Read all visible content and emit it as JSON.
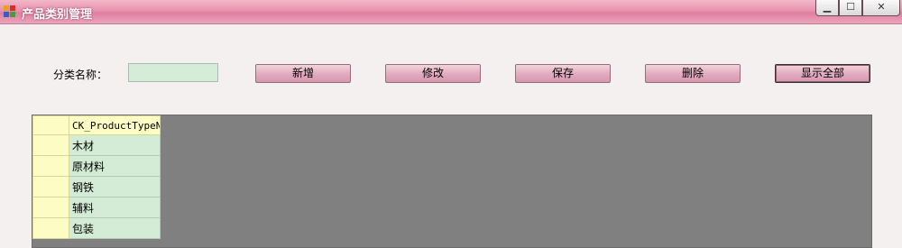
{
  "window": {
    "title": "产品类别管理",
    "caption_buttons": {
      "minimize": "▁",
      "maximize": "☐",
      "close": "✕"
    }
  },
  "form": {
    "label": "分类名称：",
    "name_value": "",
    "name_placeholder": ""
  },
  "buttons": {
    "add": "新增",
    "edit": "修改",
    "save": "保存",
    "delete": "删除",
    "show_all": "显示全部"
  },
  "grid": {
    "column_header": "CK_ProductTypeN:",
    "rows": [
      "木材",
      "原材料",
      "钢铁",
      "辅料",
      "包装"
    ]
  },
  "colors": {
    "title_bar": "#e792ae",
    "button": "#e3adc1",
    "grid_background": "#808080",
    "header": "#fdfcc4",
    "cell": "#d4ebd5"
  }
}
